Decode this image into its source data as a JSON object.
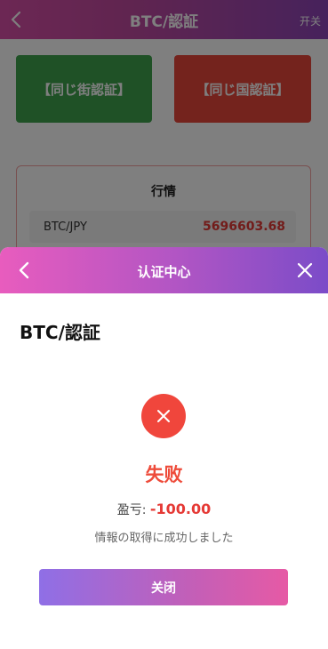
{
  "background": {
    "header": {
      "title": "BTC/認証",
      "switch_label": "开关"
    },
    "buttons": {
      "street": "【同じ街認証】",
      "country": "【同じ国認証】"
    },
    "market": {
      "title": "行情",
      "rows": [
        {
          "pair": "BTC/JPY",
          "price": "5696603.68"
        }
      ]
    }
  },
  "modal": {
    "header_title": "认证中心",
    "subtitle": "BTC/認証",
    "status": "失败",
    "pnl_label": "盈亏: ",
    "pnl_value": "-100.00",
    "info": "情報の取得に成功しました",
    "close_label": "关闭"
  },
  "icons": {
    "back": "chevron-left-icon",
    "close": "close-icon",
    "fail": "x-circle-icon"
  },
  "colors": {
    "accent_pink": "#e85cbe",
    "accent_purple": "#7b4cc8",
    "fail_red": "#f0463c",
    "street_green": "#3fa34d",
    "country_red": "#e9463a"
  }
}
